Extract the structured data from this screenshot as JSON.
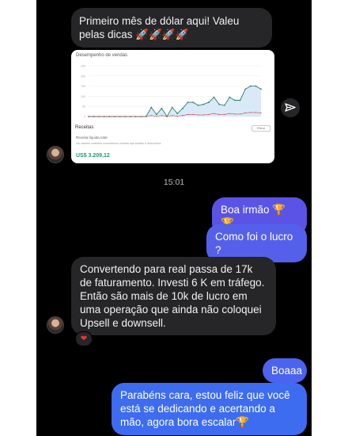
{
  "messages": {
    "m1": "Primeiro mês de dólar aqui! Valeu pelas dicas 🚀🚀🚀🚀",
    "card": {
      "title": "Desempenho de vendas",
      "section": "Receitas",
      "filter_btn": "Filtrar",
      "subtitle": "Receita líquida total",
      "description": "Os valores exibidos consideram vendas aprovadas e descontos",
      "amount": "US$ 3.209,12"
    },
    "time": "15:01",
    "m2": "Boa irmão 🏆🏆",
    "m3": "Como foi o lucro ?",
    "m4": "Convertendo para real passa de 17k de faturamento. Investi 6 K em tráfego. Então são mais de 10k de lucro em uma operação que ainda não coloquei Upsell e downsell.",
    "reaction": "❤",
    "m5": "Boaaa",
    "m6": "Parabéns cara, estou feliz que você está se dedicando e acertando a mão, agora bora escalar🏆"
  },
  "colors": {
    "bubble_out_top": "#6b4fe0",
    "bubble_out_bottom": "#3b6cf2",
    "bubble_in": "#262628",
    "chart_line": "#2e7d6a",
    "chart_area": "#cfe3f5"
  },
  "chart_data": {
    "type": "line",
    "title": "Desempenho de vendas",
    "series": [
      {
        "values": [
          0,
          0,
          0,
          0,
          0,
          0,
          0,
          0,
          0,
          0,
          0,
          0,
          45,
          10,
          40,
          0,
          45,
          15,
          40,
          70,
          70,
          55,
          60,
          70,
          95,
          60,
          55,
          95,
          80,
          80,
          135,
          150,
          150,
          135
        ]
      },
      {
        "values": [
          0,
          0,
          0,
          0,
          0,
          0,
          0,
          0,
          0,
          0,
          0,
          0,
          5,
          0,
          5,
          0,
          5,
          2,
          5,
          10,
          10,
          8,
          8,
          10,
          15,
          10,
          10,
          15,
          12,
          12,
          18,
          20,
          20,
          18
        ]
      }
    ],
    "ylim": [
      0,
      250
    ],
    "y_ticks": [
      "250",
      "200",
      "150",
      "100",
      "50",
      "0"
    ]
  }
}
